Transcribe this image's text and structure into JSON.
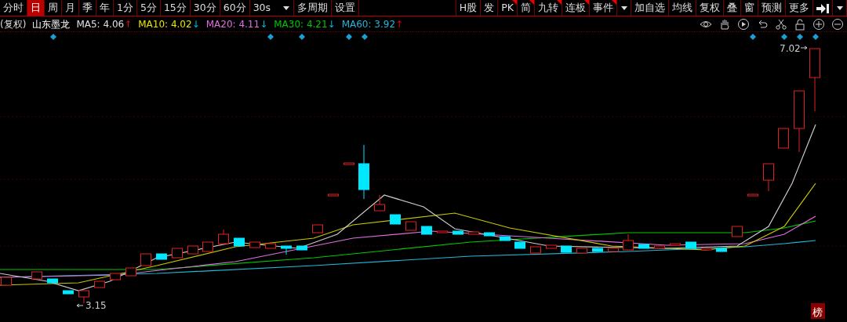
{
  "period_tabs": [
    {
      "label": "分时",
      "selected": false
    },
    {
      "label": "日",
      "selected": true
    },
    {
      "label": "周",
      "selected": false
    },
    {
      "label": "月",
      "selected": false
    },
    {
      "label": "季",
      "selected": false
    },
    {
      "label": "年",
      "selected": false
    },
    {
      "label": "1分",
      "selected": false
    },
    {
      "label": "5分",
      "selected": false
    },
    {
      "label": "15分",
      "selected": false
    },
    {
      "label": "30分",
      "selected": false
    },
    {
      "label": "60分",
      "selected": false
    }
  ],
  "interval_dropdown": {
    "value": "30s"
  },
  "left_buttons": [
    "多周期",
    "设置"
  ],
  "right_tools": [
    {
      "label": "H股",
      "flagged": false
    },
    {
      "label": "发",
      "flagged": false
    },
    {
      "label": "PK",
      "flagged": true
    },
    {
      "label": "简",
      "flagged": true
    },
    {
      "label": "九转",
      "flagged": true
    },
    {
      "label": "连板",
      "flagged": true
    },
    {
      "label": "事件",
      "flagged": true
    }
  ],
  "right_buttons": [
    "加自选",
    "均线",
    "复权",
    "叠",
    "窗",
    "预测",
    "更多"
  ],
  "info": {
    "adjust": "(复权)",
    "stock_name": "山东墨龙",
    "ma": [
      {
        "label": "MA5: 4.06",
        "color": "#e0e0e0",
        "arrow": "↑",
        "kind": "up"
      },
      {
        "label": "MA10: 4.02",
        "color": "#e6e600",
        "arrow": "↓",
        "kind": "down"
      },
      {
        "label": "MA20: 4.11",
        "color": "#e070e0",
        "arrow": "↓",
        "kind": "down"
      },
      {
        "label": "MA30: 4.21",
        "color": "#00c800",
        "arrow": "↓",
        "kind": "down"
      },
      {
        "label": "MA60: 3.92",
        "color": "#20b8d8",
        "arrow": "↑",
        "kind": "up"
      }
    ]
  },
  "chart": {
    "high_label": "7.02",
    "low_label": "3.15",
    "corner_badge": "榜"
  }
}
